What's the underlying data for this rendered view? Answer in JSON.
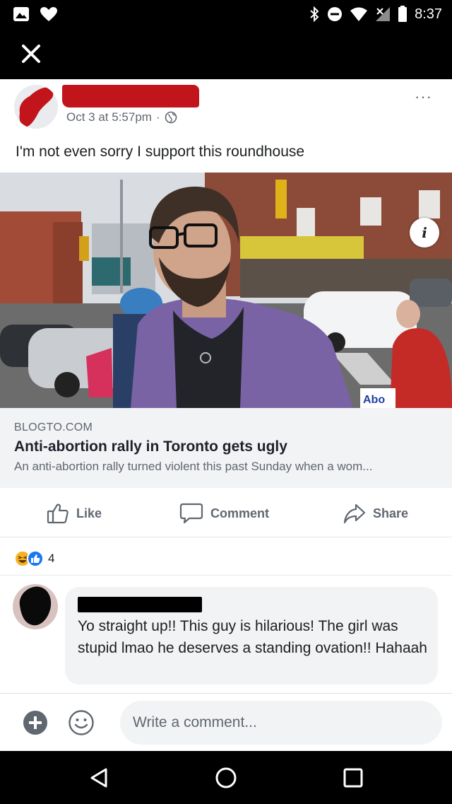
{
  "status_bar": {
    "time": "8:37",
    "left_icons": [
      "image-icon",
      "heart-icon"
    ],
    "right_icons": [
      "bluetooth-icon",
      "do-not-disturb-icon",
      "wifi-icon",
      "no-signal-icon",
      "battery-icon"
    ]
  },
  "toolbar": {
    "close_icon": "close-icon"
  },
  "post": {
    "timestamp": "Oct 3 at 5:57pm",
    "separator": "·",
    "audience_icon": "globe-icon",
    "more_label": "···",
    "text": "I'm not even sorry I support this roundhouse"
  },
  "link": {
    "domain": "BLOGTO.COM",
    "title": "Anti-abortion rally in Toronto gets ugly",
    "description": "An anti-abortion rally turned violent this past Sunday when a wom...",
    "image_sign_text": "Abo",
    "info_label": "i"
  },
  "actions": {
    "like": "Like",
    "comment": "Comment",
    "share": "Share"
  },
  "reactions": {
    "types": [
      "haha",
      "like"
    ],
    "count": "4",
    "colors": {
      "haha": "#f7b125",
      "like": "#1877f2"
    }
  },
  "comment": {
    "text": "Yo straight up!! This guy is hilarious! The girl was stupid lmao he deserves a standing ovation!! Hahaah"
  },
  "composer": {
    "placeholder": "Write a comment...",
    "plus_icon": "plus-circle-icon",
    "emoji_icon": "smiley-icon"
  },
  "nav": [
    "back-icon",
    "home-icon",
    "recents-icon"
  ],
  "colors": {
    "redaction_red": "#c2151b",
    "text_primary": "#1c1e21",
    "text_secondary": "#606770",
    "link_bg": "#f2f3f5"
  }
}
